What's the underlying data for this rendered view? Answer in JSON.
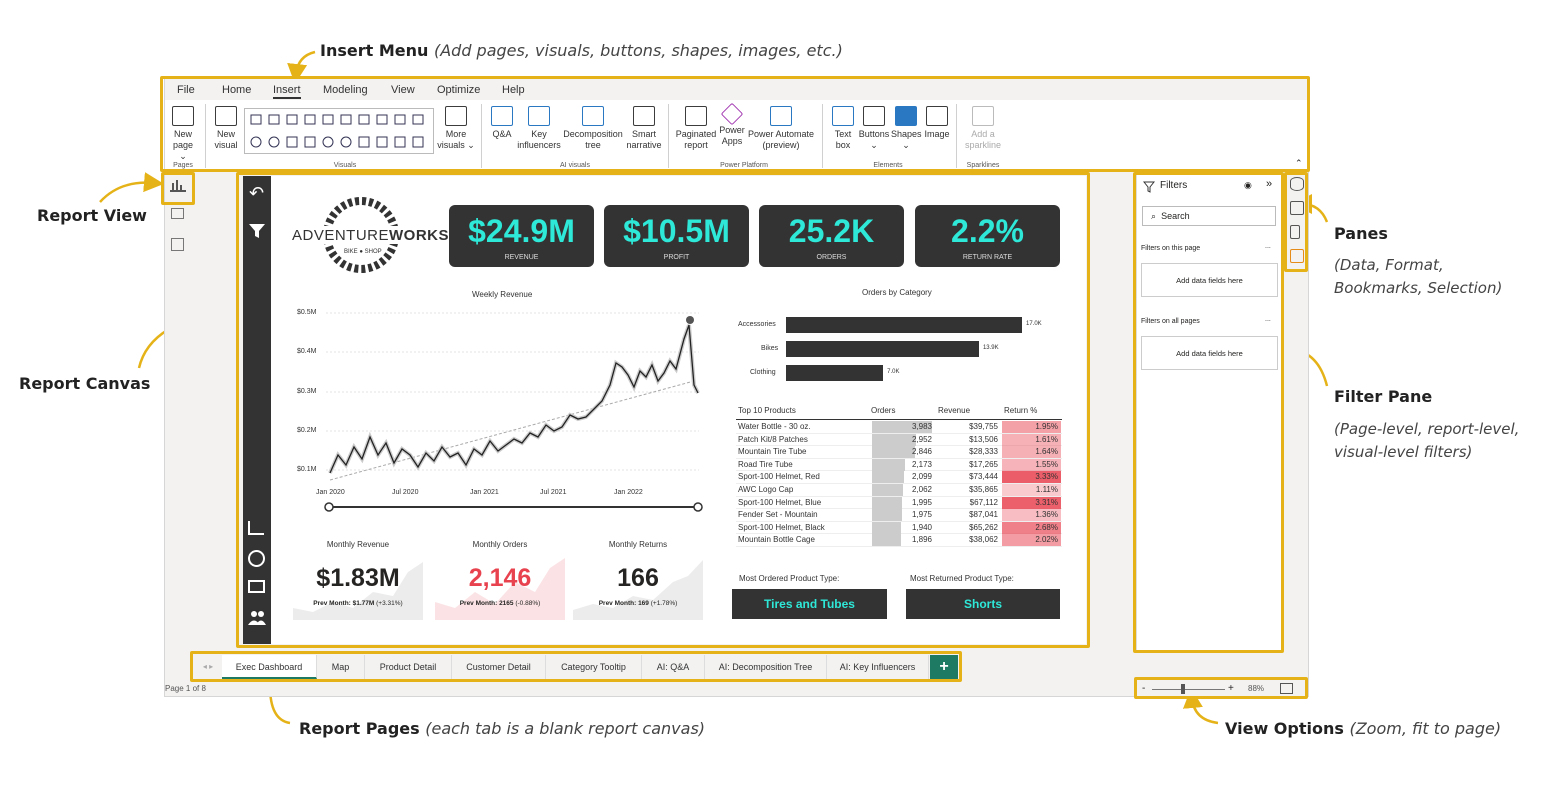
{
  "callouts": {
    "insert_menu": {
      "title": "Insert Menu",
      "desc": "(Add pages, visuals, buttons, shapes, images, etc.)"
    },
    "report_view": "Report View",
    "report_canvas": "Report Canvas",
    "panes": {
      "title": "Panes",
      "desc1": "(Data, Format,",
      "desc2": "Bookmarks, Selection)"
    },
    "filter_pane": {
      "title": "Filter Pane",
      "desc1": "(Page-level, report-level,",
      "desc2": "visual-level filters)"
    },
    "report_pages": {
      "title": "Report Pages",
      "desc": "(each tab is a blank report canvas)"
    },
    "view_options": {
      "title": "View Options",
      "desc": "(Zoom, fit to page)"
    }
  },
  "menu": {
    "tabs": [
      "File",
      "Home",
      "Insert",
      "Modeling",
      "View",
      "Optimize",
      "Help"
    ],
    "active": "Insert"
  },
  "ribbon": {
    "new_page": [
      "New",
      "page ⌄"
    ],
    "new_visual": [
      "New",
      "visual"
    ],
    "more_visuals": [
      "More",
      "visuals ⌄"
    ],
    "qa": "Q&A",
    "key_influencers": [
      "Key",
      "influencers"
    ],
    "decomposition": [
      "Decomposition",
      "tree"
    ],
    "smart_narrative": [
      "Smart",
      "narrative"
    ],
    "paginated": [
      "Paginated",
      "report"
    ],
    "power_apps": [
      "Power",
      "Apps"
    ],
    "power_automate": [
      "Power Automate",
      "(preview)"
    ],
    "text_box": [
      "Text",
      "box"
    ],
    "buttons": [
      "Buttons",
      "⌄"
    ],
    "shapes": [
      "Shapes",
      "⌄"
    ],
    "image": "Image",
    "sparkline": [
      "Add a",
      "sparkline"
    ],
    "groups": {
      "pages": "Pages",
      "visuals": "Visuals",
      "ai": "AI visuals",
      "power": "Power Platform",
      "elements": "Elements",
      "sparklines": "Sparklines"
    }
  },
  "kpis": [
    {
      "value": "$24.9M",
      "label": "REVENUE"
    },
    {
      "value": "$10.5M",
      "label": "PROFIT"
    },
    {
      "value": "25.2K",
      "label": "ORDERS"
    },
    {
      "value": "2.2%",
      "label": "RETURN RATE"
    }
  ],
  "logo": {
    "text_a": "ADVENTURE",
    "text_b": "WORKS",
    "sub1": "BIKE",
    "sub2": "SHOP"
  },
  "weekly_revenue": {
    "title": "Weekly Revenue",
    "y_ticks": [
      "$0.5M",
      "$0.4M",
      "$0.3M",
      "$0.2M",
      "$0.1M"
    ],
    "x_ticks": [
      "Jan 2020",
      "Jul 2020",
      "Jan 2021",
      "Jul 2021",
      "Jan 2022"
    ]
  },
  "orders_by_category": {
    "title": "Orders by Category",
    "bars": [
      {
        "label": "Accessories",
        "value": 17.0,
        "text": "17.0K"
      },
      {
        "label": "Bikes",
        "value": 13.9,
        "text": "13.9K"
      },
      {
        "label": "Clothing",
        "value": 7.0,
        "text": "7.0K"
      }
    ]
  },
  "top_products": {
    "headers": [
      "Top 10 Products",
      "Orders",
      "Revenue",
      "Return %"
    ],
    "rows": [
      {
        "name": "Water Bottle - 30 oz.",
        "orders": "3,983",
        "revenue": "$39,755",
        "ret": "1.95%",
        "o": 3983,
        "r": 1.95
      },
      {
        "name": "Patch Kit/8 Patches",
        "orders": "2,952",
        "revenue": "$13,506",
        "ret": "1.61%",
        "o": 2952,
        "r": 1.61
      },
      {
        "name": "Mountain Tire Tube",
        "orders": "2,846",
        "revenue": "$28,333",
        "ret": "1.64%",
        "o": 2846,
        "r": 1.64
      },
      {
        "name": "Road Tire Tube",
        "orders": "2,173",
        "revenue": "$17,265",
        "ret": "1.55%",
        "o": 2173,
        "r": 1.55
      },
      {
        "name": "Sport-100 Helmet, Red",
        "orders": "2,099",
        "revenue": "$73,444",
        "ret": "3.33%",
        "o": 2099,
        "r": 3.33
      },
      {
        "name": "AWC Logo Cap",
        "orders": "2,062",
        "revenue": "$35,865",
        "ret": "1.11%",
        "o": 2062,
        "r": 1.11
      },
      {
        "name": "Sport-100 Helmet, Blue",
        "orders": "1,995",
        "revenue": "$67,112",
        "ret": "3.31%",
        "o": 1995,
        "r": 3.31
      },
      {
        "name": "Fender Set - Mountain",
        "orders": "1,975",
        "revenue": "$87,041",
        "ret": "1.36%",
        "o": 1975,
        "r": 1.36
      },
      {
        "name": "Sport-100 Helmet, Black",
        "orders": "1,940",
        "revenue": "$65,262",
        "ret": "2.68%",
        "o": 1940,
        "r": 2.68
      },
      {
        "name": "Mountain Bottle Cage",
        "orders": "1,896",
        "revenue": "$38,062",
        "ret": "2.02%",
        "o": 1896,
        "r": 2.02
      }
    ]
  },
  "monthly": [
    {
      "title": "Monthly Revenue",
      "value": "$1.83M",
      "prev": "Prev Month: $1.77M",
      "delta": "(+3.31%)",
      "color": "#252423"
    },
    {
      "title": "Monthly Orders",
      "value": "2,146",
      "prev": "Prev Month: 2165",
      "delta": "(-0.88%)",
      "color": "#e8424f"
    },
    {
      "title": "Monthly Returns",
      "value": "166",
      "prev": "Prev Month: 169",
      "delta": "(+1.78%)",
      "color": "#252423"
    }
  ],
  "product_types": {
    "most_ordered_label": "Most Ordered Product Type:",
    "most_ordered": "Tires and Tubes",
    "most_returned_label": "Most Returned Product Type:",
    "most_returned": "Shorts"
  },
  "filters": {
    "title": "Filters",
    "search": "Search",
    "on_page": "Filters on this page",
    "on_all": "Filters on all pages",
    "add": "Add data fields here",
    "dots": "..."
  },
  "pages": [
    "Exec Dashboard",
    "Map",
    "Product Detail",
    "Customer Detail",
    "Category Tooltip",
    "AI: Q&A",
    "AI: Decomposition Tree",
    "AI: Key Influencers"
  ],
  "add_page": "+",
  "status": {
    "page": "Page 1 of 8",
    "zoom": "88%",
    "minus": "-",
    "plus": "+"
  },
  "colors": {
    "accent": "#e5b318",
    "teal": "#2ee8d8",
    "dark": "#333333",
    "red": "#e8424f"
  }
}
